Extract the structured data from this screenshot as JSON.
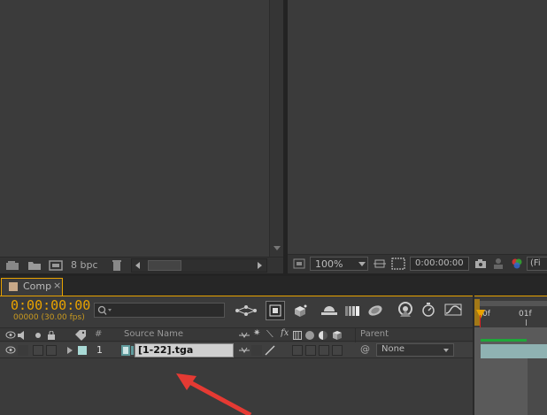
{
  "project_panel": {
    "bit_depth": "8 bpc"
  },
  "viewer_panel": {
    "zoom": "100%",
    "timecode": "0:00:00:00",
    "view_label": "(Fi"
  },
  "timeline": {
    "tab_label": "Comp",
    "timecode": "0:00:00:00",
    "frame_info": "00000 (30.00 fps)",
    "search_placeholder": "",
    "columns": {
      "num": "#",
      "source_name": "Source Name",
      "fx": "fx",
      "parent": "Parent"
    },
    "ruler": {
      "start": "0f",
      "next": "01f"
    },
    "layers": [
      {
        "number": "1",
        "name": "[1-22].tga",
        "parent": "None"
      }
    ],
    "accent_color": "#e8a200"
  }
}
